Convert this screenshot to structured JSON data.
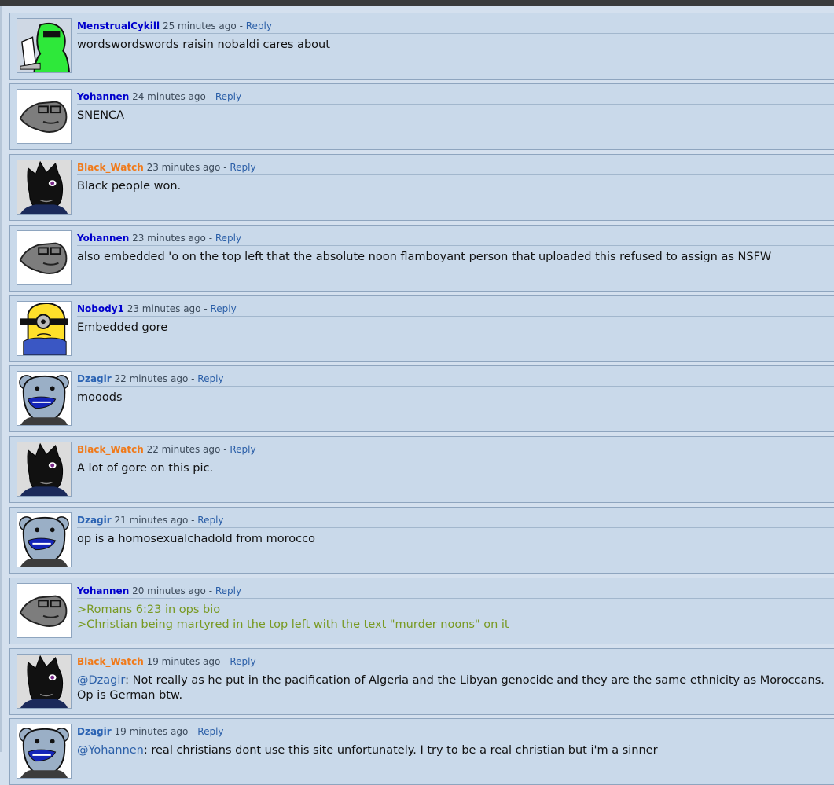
{
  "comments": [
    {
      "user": "MenstrualCykill",
      "time": "25 minutes ago",
      "sep": " - ",
      "reply": "Reply",
      "text": "wordswordswords raisin nobaldi cares about"
    },
    {
      "user": "Yohannen",
      "time": "24 minutes ago",
      "sep": " - ",
      "reply": "Reply",
      "text": "SNENCA"
    },
    {
      "user": "Black_Watch",
      "time": "23 minutes ago",
      "sep": " - ",
      "reply": "Reply",
      "text": "Black people won."
    },
    {
      "user": "Yohannen",
      "time": "23 minutes ago",
      "sep": " - ",
      "reply": "Reply",
      "text": "also embedded 'o on the top left that the absolute noon flamboyant person that uploaded this refused to assign as NSFW"
    },
    {
      "user": "Nobody1",
      "time": "23 minutes ago",
      "sep": " - ",
      "reply": "Reply",
      "text": "Embedded gore"
    },
    {
      "user": "Dzagir",
      "time": "22 minutes ago",
      "sep": " - ",
      "reply": "Reply",
      "text": "mooods"
    },
    {
      "user": "Black_Watch",
      "time": "22 minutes ago",
      "sep": " - ",
      "reply": "Reply",
      "text": "A lot of gore on this pic."
    },
    {
      "user": "Dzagir",
      "time": "21 minutes ago",
      "sep": " - ",
      "reply": "Reply",
      "text": "op is a homosexualchadold from morocco"
    },
    {
      "user": "Yohannen",
      "time": "20 minutes ago",
      "sep": " - ",
      "reply": "Reply",
      "line1": ">Romans 6:23 in ops bio",
      "line2": ">Christian being martyred in the top left with the text \"murder noons\" on it"
    },
    {
      "user": "Black_Watch",
      "time": "19 minutes ago",
      "sep": " - ",
      "reply": "Reply",
      "mention": "@Dzagir",
      "text": ": Not really as he put in the pacification of Algeria and the Libyan genocide and they are the same ethnicity as Moroccans.",
      "line2": "Op is German btw."
    },
    {
      "user": "Dzagir",
      "time": "19 minutes ago",
      "sep": " - ",
      "reply": "Reply",
      "mention": "@Yohannen",
      "text": ": real christians dont use this site unfortunately. I try to be a real christian but i'm a sinner"
    }
  ],
  "colors": {
    "username_default": "#0000cc",
    "username_orange": "#f07a1a",
    "username_blue": "#2b63b3",
    "greentext": "#789922",
    "link": "#2b5fa8"
  },
  "avatars": [
    "green-wojak-avatar",
    "gray-saluting-avatar",
    "black-wojak-avatar",
    "yellow-minion-wojak-avatar",
    "blue-bear-avatar"
  ]
}
